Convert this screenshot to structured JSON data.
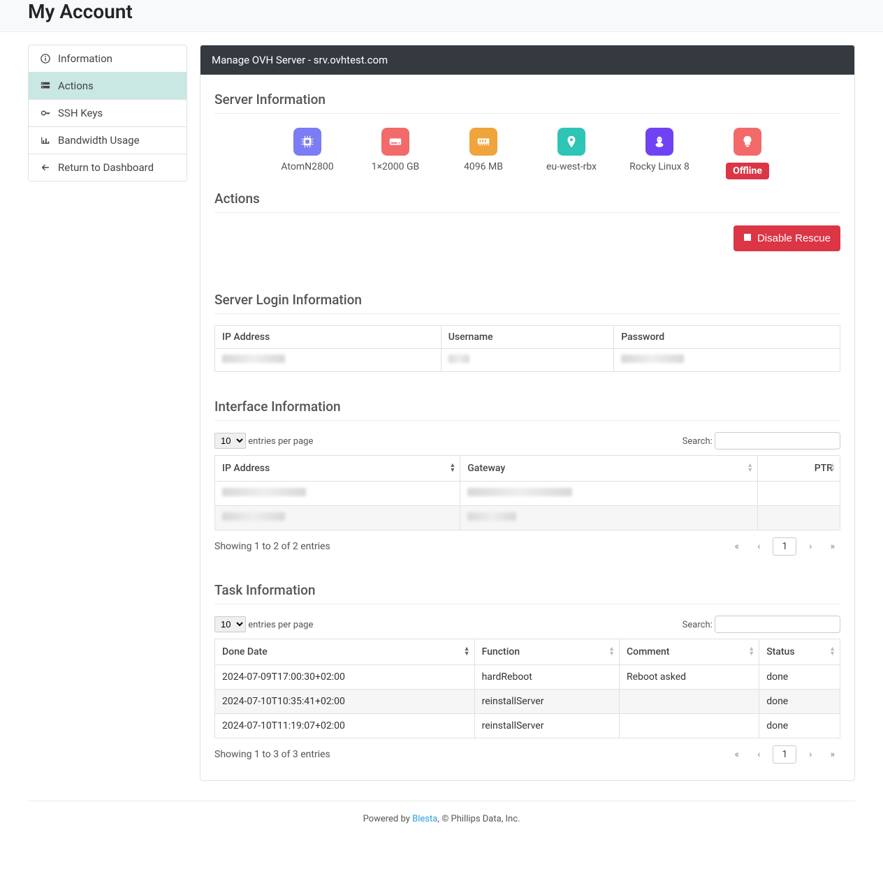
{
  "page_title": "My Account",
  "sidebar": {
    "items": [
      {
        "label": "Information"
      },
      {
        "label": "Actions"
      },
      {
        "label": "SSH Keys"
      },
      {
        "label": "Bandwidth Usage"
      },
      {
        "label": "Return to Dashboard"
      }
    ]
  },
  "panel_title": "Manage OVH Server - srv.ovhtest.com",
  "sections": {
    "server_info_title": "Server Information",
    "actions_title": "Actions",
    "login_info_title": "Server Login Information",
    "interface_info_title": "Interface Information",
    "task_info_title": "Task Information"
  },
  "specs": {
    "cpu": "AtomN2800",
    "storage": "1×2000 GB",
    "memory": "4096 MB",
    "location": "eu-west-rbx",
    "os": "Rocky Linux 8",
    "status": "Offline"
  },
  "spec_colors": {
    "cpu": "#7c7cf4",
    "storage": "#f26a6a",
    "memory": "#f0a43c",
    "location": "#2ec4b6",
    "os": "#6f42f4",
    "bulb": "#f26a6a"
  },
  "disable_rescue_button": "Disable Rescue",
  "login_table": {
    "col_ip": "IP Address",
    "col_user": "Username",
    "col_pass": "Password"
  },
  "datatable": {
    "entries_per_page_label": " entries per page",
    "search_label": "Search:",
    "page_size": "10"
  },
  "interface_table": {
    "col_ip": "IP Address",
    "col_gateway": "Gateway",
    "col_ptr": "PTR",
    "showing": "Showing 1 to 2 of 2 entries",
    "page": "1"
  },
  "task_table": {
    "col_done": "Done Date",
    "col_function": "Function",
    "col_comment": "Comment",
    "col_status": "Status",
    "rows": [
      {
        "done": "2024-07-09T17:00:30+02:00",
        "func": "hardReboot",
        "comment": "Reboot asked",
        "status": "done"
      },
      {
        "done": "2024-07-10T10:35:41+02:00",
        "func": "reinstallServer",
        "comment": "",
        "status": "done"
      },
      {
        "done": "2024-07-10T11:19:07+02:00",
        "func": "reinstallServer",
        "comment": "",
        "status": "done"
      }
    ],
    "showing": "Showing 1 to 3 of 3 entries",
    "page": "1"
  },
  "pagination_glyphs": {
    "first": "«",
    "prev": "‹",
    "next": "›",
    "last": "»"
  },
  "footer": {
    "powered_by": "Powered by ",
    "vendor": "Blesta",
    "tail": ", © Phillips Data, Inc."
  }
}
